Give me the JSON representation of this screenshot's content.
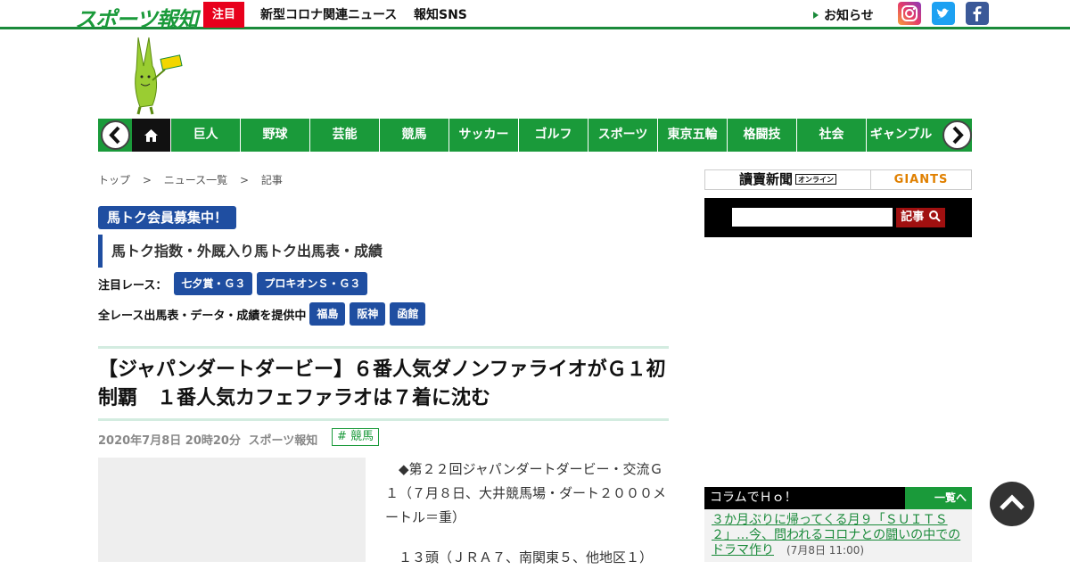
{
  "header": {
    "logo": "スポーツ報知",
    "chumoku": "注目",
    "links": [
      "新型コロナ関連ニュース",
      "報知SNS"
    ],
    "notice": "お知らせ",
    "sns": [
      "instagram-icon",
      "twitter-icon",
      "facebook-icon"
    ]
  },
  "nav": {
    "items": [
      "巨人",
      "野球",
      "芸能",
      "競馬",
      "サッカー",
      "ゴルフ",
      "スポーツ",
      "東京五輪",
      "格闘技",
      "社会",
      "ギャンブル"
    ]
  },
  "breadcrumb": [
    "トップ",
    ">",
    "ニュース一覧",
    ">",
    "記事"
  ],
  "umatoku": {
    "badge": "馬トク会員募集中！",
    "subtitle": "馬トク指数・外厩入り馬トク出馬表・成績",
    "race_label": "注目レース：",
    "races": [
      "七夕賞・Ｇ３",
      "プロキオンＳ・Ｇ３"
    ],
    "all_label": "全レース出馬表・データ・成績を提供中",
    "venues": [
      "福島",
      "阪神",
      "函館"
    ]
  },
  "article": {
    "headline": "【ジャパンダートダービー】６番人気ダノンファライオがＧ１初制覇　１番人気カフェファラオは７着に沈む",
    "date": "2020年7月8日 20時20分",
    "source": "スポーツ報知",
    "tag": "# 競馬",
    "body": [
      "◆第２２回ジャパンダートダービー・交流Ｇ１（７月８日、大井競馬場・ダート２０００メートル＝重）",
      "１３頭（ＪＲＡ７、南関東５、他地区１）"
    ]
  },
  "sidebar": {
    "yomiuri": "讀賣新聞",
    "yomiuri_badge": "オンライン",
    "giants": "GIANTS",
    "search_button": "記事",
    "column_title": "コラムでＨｏ！",
    "column_more": "一覧へ",
    "column_item_title": "３か月ぶりに帰ってくる月９「ＳＵＩＴＳ２」…今、問われるコロナとの闘いの中でのドラマ作り",
    "column_item_date": "(7月8日 11:00)"
  }
}
